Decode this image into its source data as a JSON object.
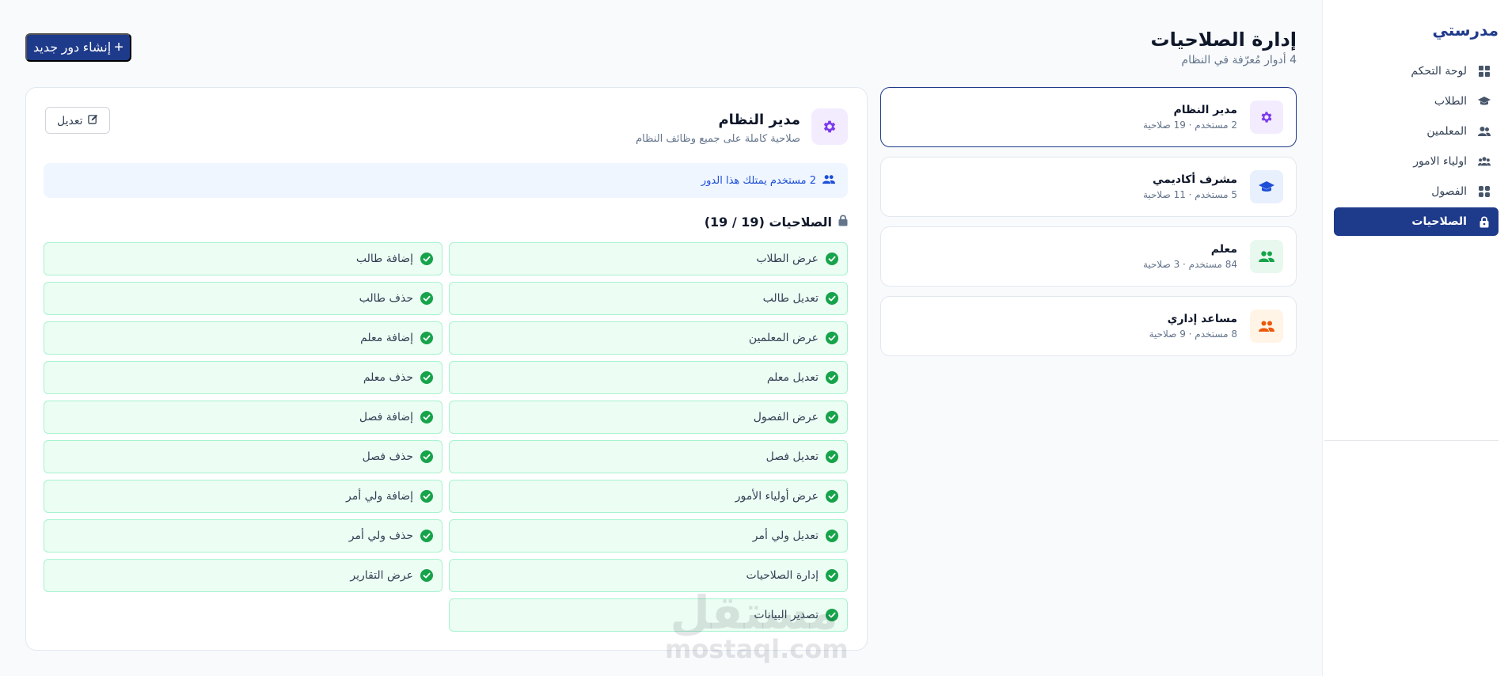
{
  "sidebar": {
    "brand": "مدرستي",
    "items": [
      {
        "label": "لوحة التحكم",
        "icon": "dashboard-icon",
        "active": false
      },
      {
        "label": "الطلاب",
        "icon": "graduation-cap-icon",
        "active": false
      },
      {
        "label": "المعلمين",
        "icon": "users-icon",
        "active": false
      },
      {
        "label": "اولياء الامور",
        "icon": "users-group-icon",
        "active": false
      },
      {
        "label": "الفصول",
        "icon": "grid-icon",
        "active": false
      },
      {
        "label": "الصلاحيات",
        "icon": "lock-icon",
        "active": true
      }
    ]
  },
  "header": {
    "title": "إدارة الصلاحيات",
    "subtitle": "4 أدوار مُعرّفة في النظام",
    "create_button": "إنشاء دور جديد"
  },
  "roles": [
    {
      "name": "مدير النظام",
      "meta": "2 مستخدم · 19 صلاحية",
      "icon": "gear-icon",
      "color": "#7c3aed",
      "bg": "#f3ecff",
      "selected": true
    },
    {
      "name": "مشرف أكاديمي",
      "meta": "5 مستخدم · 11 صلاحية",
      "icon": "graduation-cap-icon",
      "color": "#1d4ed8",
      "bg": "#e8f0fe",
      "selected": false
    },
    {
      "name": "معلم",
      "meta": "84 مستخدم · 3 صلاحية",
      "icon": "users-icon",
      "color": "#16a34a",
      "bg": "#e8f8ee",
      "selected": false
    },
    {
      "name": "مساعد إداري",
      "meta": "8 مستخدم · 9 صلاحية",
      "icon": "user-group-icon",
      "color": "#ea580c",
      "bg": "#fff4e6",
      "selected": false
    }
  ],
  "details": {
    "title": "مدير النظام",
    "description": "صلاحية كاملة على جميع وظائف النظام",
    "edit_label": "تعديل",
    "users_banner": "2 مستخدم يمتلك هذا الدور",
    "permissions_heading": "الصلاحيات (19 / 19)",
    "permissions": [
      "عرض الطلاب",
      "إضافة طالب",
      "تعديل طالب",
      "حذف طالب",
      "عرض المعلمين",
      "إضافة معلم",
      "تعديل معلم",
      "حذف معلم",
      "عرض الفصول",
      "إضافة فصل",
      "تعديل فصل",
      "حذف فصل",
      "عرض أولياء الأمور",
      "إضافة ولي أمر",
      "تعديل ولي أمر",
      "حذف ولي أمر",
      "إدارة الصلاحيات",
      "عرض التقارير",
      "تصدير البيانات"
    ]
  },
  "watermark": {
    "logo": "مستقل",
    "url": "mostaql.com"
  }
}
